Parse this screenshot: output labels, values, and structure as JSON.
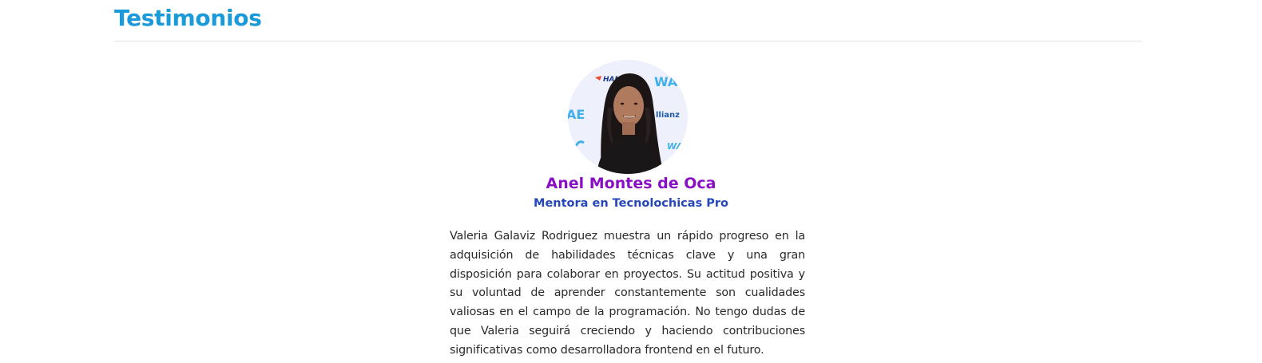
{
  "section": {
    "title": "Testimonios"
  },
  "testimonial": {
    "name": "Anel Montes de Oca",
    "role": "Mentora en Tecnolochicas Pro",
    "quote": "Valeria Galaviz Rodriguez muestra un rápido progreso en la adquisición de habilidades técnicas clave y una gran disposición para colaborar en proyectos. Su actitud positiva y su voluntad de aprender constantemente son cualidades valiosas en el campo de la programación. No tengo dudas de que Valeria seguirá creciendo y haciendo contribuciones significativas como desarrolladora frontend en el futuro.",
    "photo_backdrop_text": [
      "HAN",
      "WA",
      "AE",
      "llianz",
      "WA"
    ]
  },
  "colors": {
    "title": "#1a9ad9",
    "name": "#8a0fc4",
    "role": "#2548b8",
    "body_text": "#2a2a2a",
    "divider": "#e3e3e3"
  }
}
